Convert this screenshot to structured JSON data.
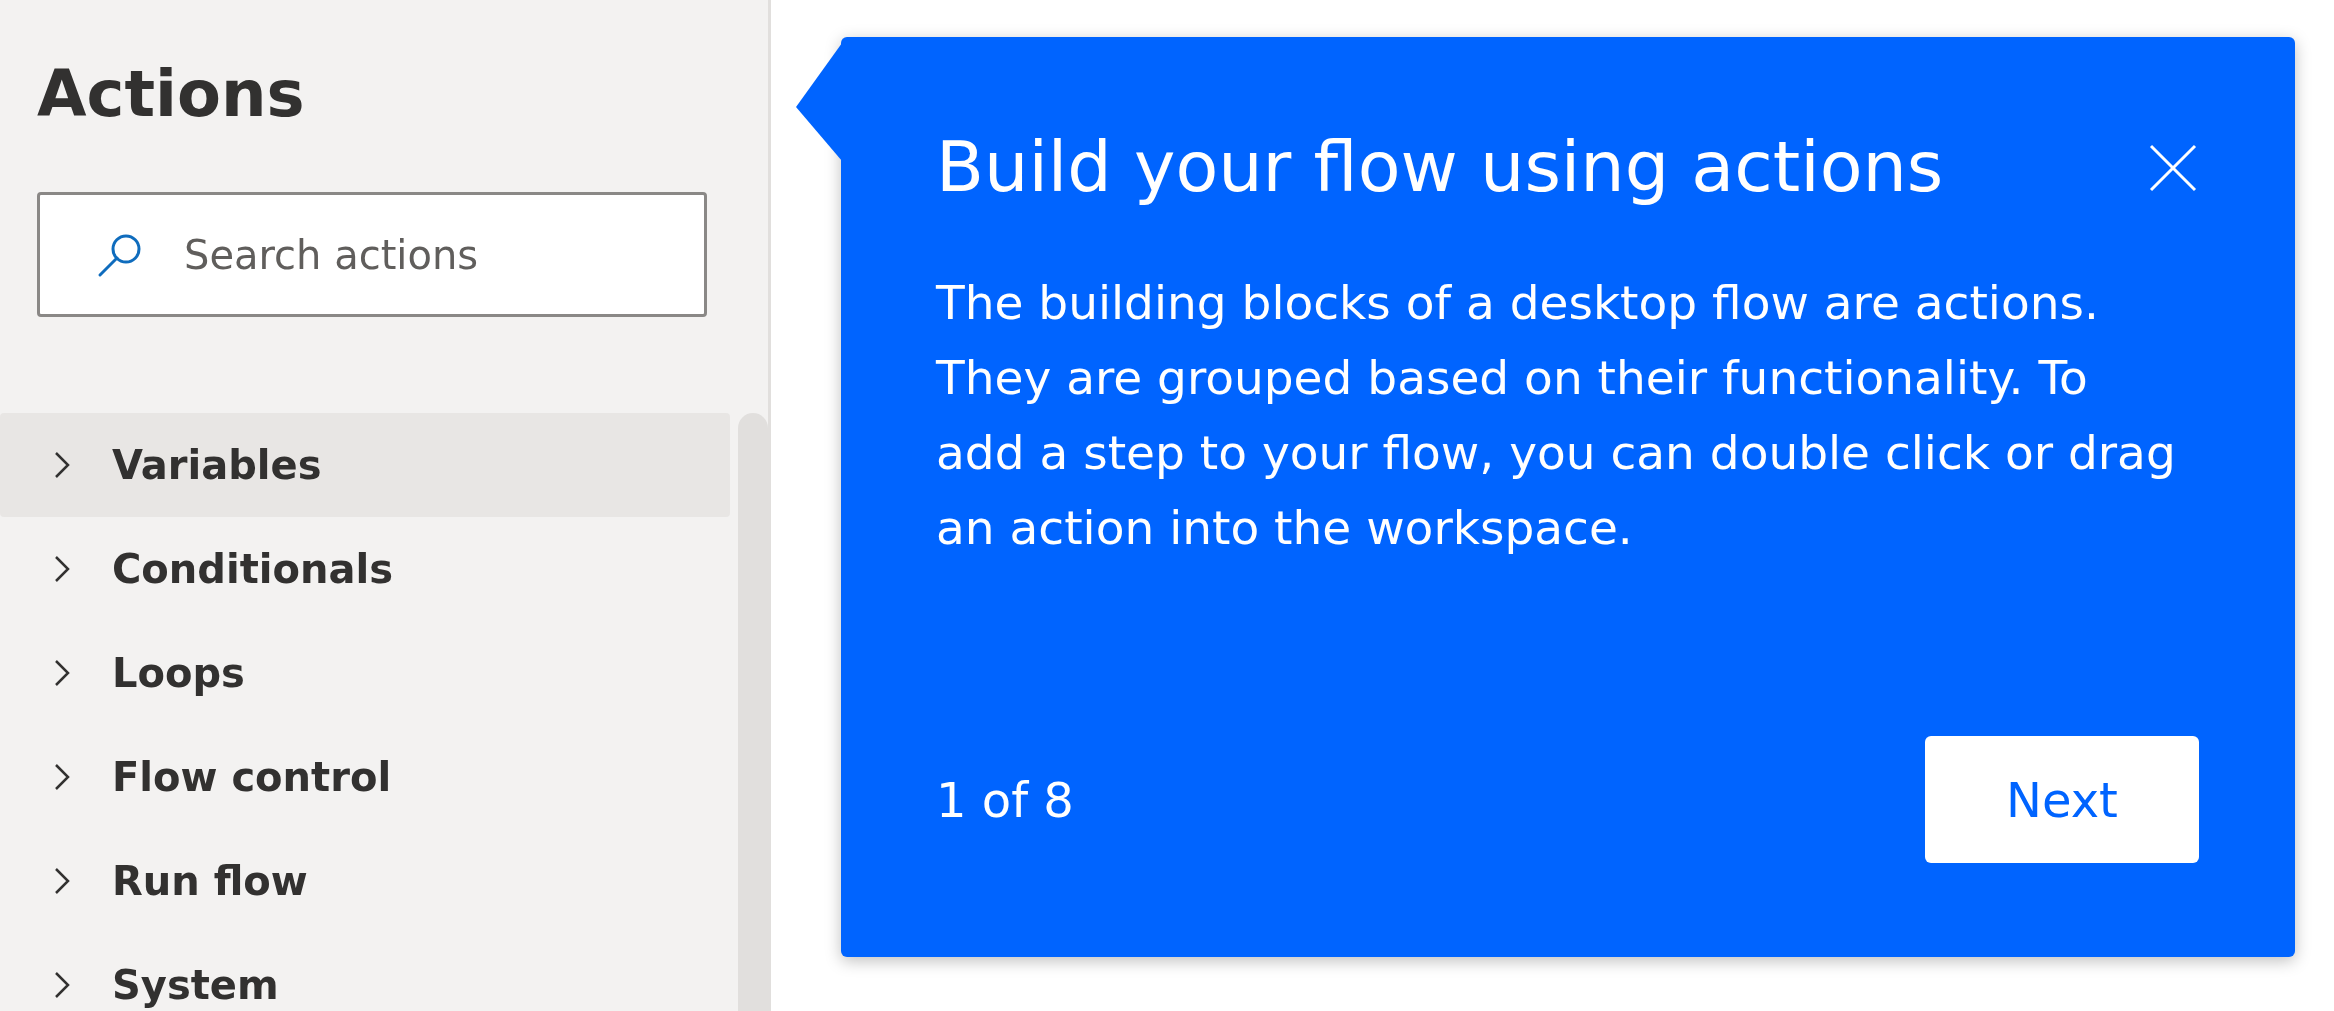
{
  "sidebar": {
    "title": "Actions",
    "search": {
      "placeholder": "Search actions"
    },
    "items": [
      {
        "label": "Variables",
        "selected": true,
        "expanded": false
      },
      {
        "label": "Conditionals",
        "selected": false,
        "expanded": false
      },
      {
        "label": "Loops",
        "selected": false,
        "expanded": false
      },
      {
        "label": "Flow control",
        "selected": false,
        "expanded": false
      },
      {
        "label": "Run flow",
        "selected": false,
        "expanded": false
      },
      {
        "label": "System",
        "selected": false,
        "expanded": false
      }
    ]
  },
  "callout": {
    "title": "Build your flow using actions",
    "body": "The building blocks of a desktop flow are actions. They are grouped based on their functionality. To add a step to your flow, you can double click or drag an action into the workspace.",
    "step": "1 of 8",
    "next_button": "Next"
  }
}
